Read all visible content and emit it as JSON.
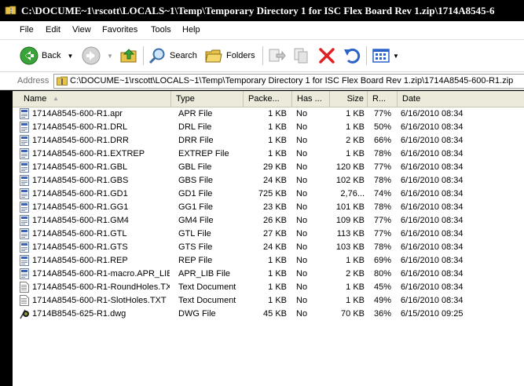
{
  "window": {
    "title": "C:\\DOCUME~1\\rscott\\LOCALS~1\\Temp\\Temporary Directory 1 for ISC Flex Board Rev 1.zip\\1714A8545-6"
  },
  "menu": [
    "File",
    "Edit",
    "View",
    "Favorites",
    "Tools",
    "Help"
  ],
  "toolbar": {
    "back_label": "Back",
    "search_label": "Search",
    "folders_label": "Folders"
  },
  "address": {
    "label": "Address",
    "value": "C:\\DOCUME~1\\rscott\\LOCALS~1\\Temp\\Temporary Directory 1 for ISC Flex Board Rev 1.zip\\1714A8545-600-R1.zip"
  },
  "columns": {
    "name": "Name",
    "type": "Type",
    "packed": "Packe...",
    "haspw": "Has ...",
    "size": "Size",
    "ratio": "R...",
    "date": "Date"
  },
  "files": [
    {
      "name": "1714A8545-600-R1.apr",
      "type": "APR File",
      "packed": "1 KB",
      "haspw": "No",
      "size": "1 KB",
      "ratio": "77%",
      "date": "6/16/2010 08:34",
      "icon": "document-icon"
    },
    {
      "name": "1714A8545-600-R1.DRL",
      "type": "DRL File",
      "packed": "1 KB",
      "haspw": "No",
      "size": "1 KB",
      "ratio": "50%",
      "date": "6/16/2010 08:34",
      "icon": "document-icon"
    },
    {
      "name": "1714A8545-600-R1.DRR",
      "type": "DRR File",
      "packed": "1 KB",
      "haspw": "No",
      "size": "2 KB",
      "ratio": "66%",
      "date": "6/16/2010 08:34",
      "icon": "document-icon"
    },
    {
      "name": "1714A8545-600-R1.EXTREP",
      "type": "EXTREP File",
      "packed": "1 KB",
      "haspw": "No",
      "size": "1 KB",
      "ratio": "78%",
      "date": "6/16/2010 08:34",
      "icon": "document-icon"
    },
    {
      "name": "1714A8545-600-R1.GBL",
      "type": "GBL File",
      "packed": "29 KB",
      "haspw": "No",
      "size": "120 KB",
      "ratio": "77%",
      "date": "6/16/2010 08:34",
      "icon": "document-icon"
    },
    {
      "name": "1714A8545-600-R1.GBS",
      "type": "GBS File",
      "packed": "24 KB",
      "haspw": "No",
      "size": "102 KB",
      "ratio": "78%",
      "date": "6/16/2010 08:34",
      "icon": "document-icon"
    },
    {
      "name": "1714A8545-600-R1.GD1",
      "type": "GD1 File",
      "packed": "725 KB",
      "haspw": "No",
      "size": "2,76...",
      "ratio": "74%",
      "date": "6/16/2010 08:34",
      "icon": "document-icon"
    },
    {
      "name": "1714A8545-600-R1.GG1",
      "type": "GG1 File",
      "packed": "23 KB",
      "haspw": "No",
      "size": "101 KB",
      "ratio": "78%",
      "date": "6/16/2010 08:34",
      "icon": "document-icon"
    },
    {
      "name": "1714A8545-600-R1.GM4",
      "type": "GM4 File",
      "packed": "26 KB",
      "haspw": "No",
      "size": "109 KB",
      "ratio": "77%",
      "date": "6/16/2010 08:34",
      "icon": "document-icon"
    },
    {
      "name": "1714A8545-600-R1.GTL",
      "type": "GTL File",
      "packed": "27 KB",
      "haspw": "No",
      "size": "113 KB",
      "ratio": "77%",
      "date": "6/16/2010 08:34",
      "icon": "document-icon"
    },
    {
      "name": "1714A8545-600-R1.GTS",
      "type": "GTS File",
      "packed": "24 KB",
      "haspw": "No",
      "size": "103 KB",
      "ratio": "78%",
      "date": "6/16/2010 08:34",
      "icon": "document-icon"
    },
    {
      "name": "1714A8545-600-R1.REP",
      "type": "REP File",
      "packed": "1 KB",
      "haspw": "No",
      "size": "1 KB",
      "ratio": "69%",
      "date": "6/16/2010 08:34",
      "icon": "document-icon"
    },
    {
      "name": "1714A8545-600-R1-macro.APR_LIB",
      "type": "APR_LIB File",
      "packed": "1 KB",
      "haspw": "No",
      "size": "2 KB",
      "ratio": "80%",
      "date": "6/16/2010 08:34",
      "icon": "document-icon"
    },
    {
      "name": "1714A8545-600-R1-RoundHoles.TXT",
      "type": "Text Document",
      "packed": "1 KB",
      "haspw": "No",
      "size": "1 KB",
      "ratio": "45%",
      "date": "6/16/2010 08:34",
      "icon": "text-file-icon"
    },
    {
      "name": "1714A8545-600-R1-SlotHoles.TXT",
      "type": "Text Document",
      "packed": "1 KB",
      "haspw": "No",
      "size": "1 KB",
      "ratio": "49%",
      "date": "6/16/2010 08:34",
      "icon": "text-file-icon"
    },
    {
      "name": "1714B8545-625-R1.dwg",
      "type": "DWG File",
      "packed": "45 KB",
      "haspw": "No",
      "size": "70 KB",
      "ratio": "36%",
      "date": "6/15/2010 09:25",
      "icon": "dwg-file-icon"
    }
  ]
}
